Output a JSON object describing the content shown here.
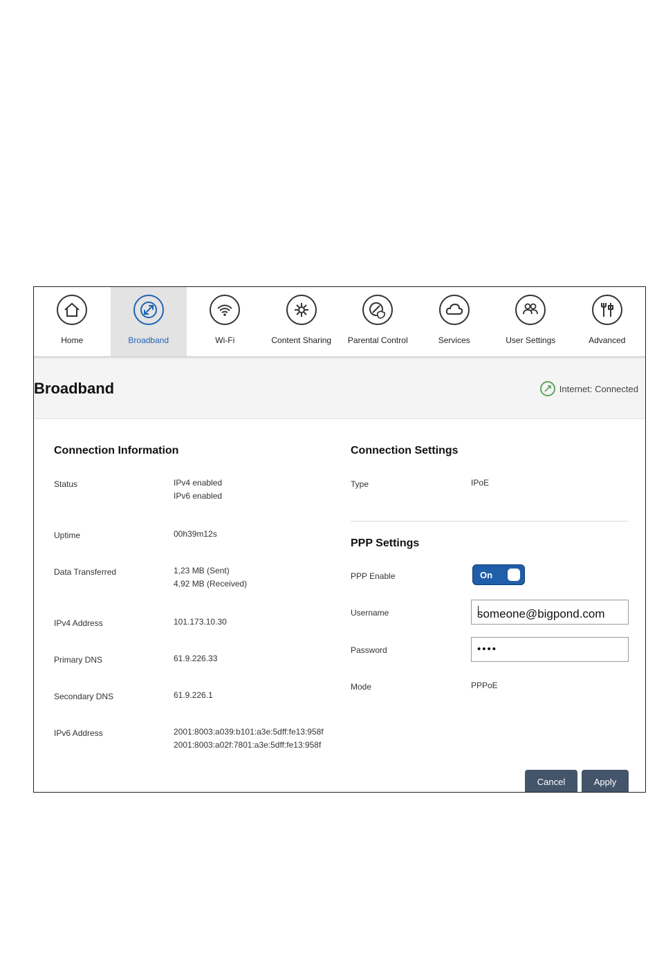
{
  "nav": {
    "items": [
      {
        "label": "Home",
        "icon": "home-icon"
      },
      {
        "label": "Broadband",
        "icon": "broadband-icon"
      },
      {
        "label": "Wi-Fi",
        "icon": "wifi-icon"
      },
      {
        "label": "Content Sharing",
        "icon": "content-sharing-icon"
      },
      {
        "label": "Parental Control",
        "icon": "parental-control-icon"
      },
      {
        "label": "Services",
        "icon": "services-icon"
      },
      {
        "label": "User Settings",
        "icon": "user-settings-icon"
      },
      {
        "label": "Advanced",
        "icon": "advanced-icon"
      }
    ],
    "active": "Broadband"
  },
  "header": {
    "title": "Broadband",
    "status": "Internet: Connected"
  },
  "connection_info": {
    "title": "Connection Information",
    "status_label": "Status",
    "status_v1": "IPv4 enabled",
    "status_v2": "IPv6 enabled",
    "uptime_label": "Uptime",
    "uptime": "00h39m12s",
    "data_label": "Data Transferred",
    "data_sent": "1,23 MB (Sent)",
    "data_received": "4,92 MB (Received)",
    "ipv4_label": "IPv4 Address",
    "ipv4": "101.173.10.30",
    "dns1_label": "Primary DNS",
    "dns1": "61.9.226.33",
    "dns2_label": "Secondary DNS",
    "dns2": "61.9.226.1",
    "ipv6_label": "IPv6 Address",
    "ipv6_1": "2001:8003:a039:b101:a3e:5dff:fe13:958f",
    "ipv6_2": "2001:8003:a02f:7801:a3e:5dff:fe13:958f"
  },
  "connection_settings": {
    "title": "Connection Settings",
    "type_label": "Type",
    "type": "IPoE"
  },
  "ppp": {
    "title": "PPP Settings",
    "enable_label": "PPP Enable",
    "enable_state": "On",
    "username_label": "Username",
    "username": "someone@bigpond.com",
    "password_label": "Password",
    "password_mask": "••••",
    "mode_label": "Mode",
    "mode": "PPPoE"
  },
  "actions": {
    "cancel": "Cancel",
    "apply": "Apply"
  },
  "colors": {
    "accent": "#1f64b3",
    "toggle": "#1f5ea8",
    "button": "#44546a",
    "status_ok": "#5aa55a"
  }
}
